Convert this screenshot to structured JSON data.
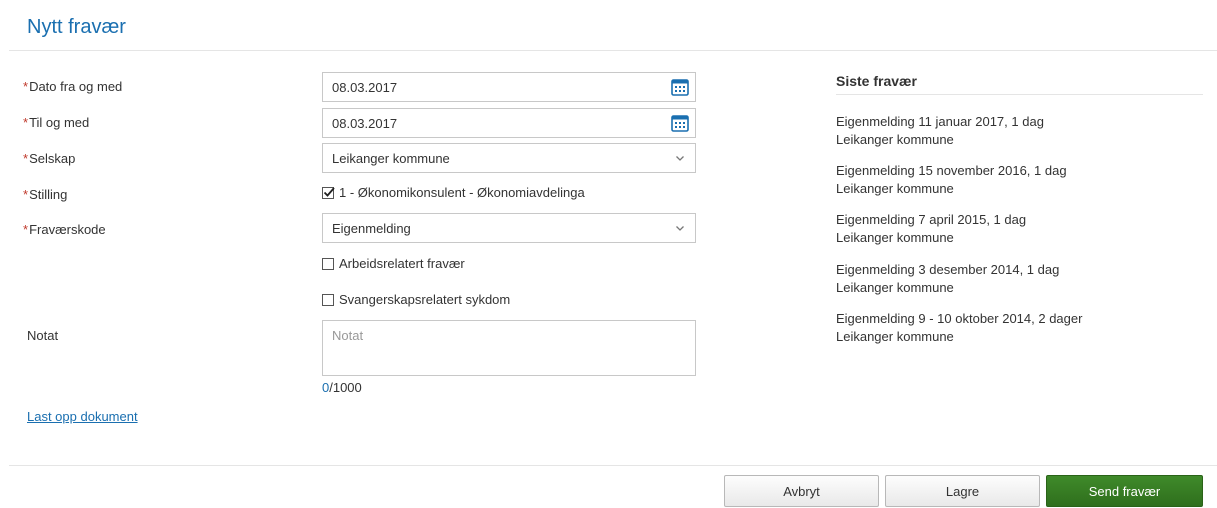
{
  "page": {
    "title": "Nytt fravær"
  },
  "form": {
    "required_mark": "*",
    "date_from": {
      "label": "Dato fra og med",
      "value": "08.03.2017"
    },
    "date_to": {
      "label": "Til og med",
      "value": "08.03.2017"
    },
    "company": {
      "label": "Selskap",
      "value": "Leikanger kommune"
    },
    "position": {
      "label": "Stilling",
      "option": "1 - Økonomikonsulent - Økonomiavdelinga",
      "checked": true
    },
    "absence_code": {
      "label": "Fraværskode",
      "value": "Eigenmelding"
    },
    "work_related": {
      "label": "Arbeidsrelatert fravær",
      "checked": false
    },
    "pregnancy_related": {
      "label": "Svangerskapsrelatert sykdom",
      "checked": false
    },
    "note": {
      "label": "Notat",
      "placeholder": "Notat",
      "count": "0",
      "max": "/1000"
    },
    "upload_link": "Last opp dokument"
  },
  "sidebar": {
    "title": "Siste fravær",
    "items": [
      {
        "line1": "Eigenmelding 11 januar 2017, 1 dag",
        "line2": "Leikanger kommune"
      },
      {
        "line1": "Eigenmelding 15 november 2016, 1 dag",
        "line2": "Leikanger kommune"
      },
      {
        "line1": "Eigenmelding 7 april 2015, 1 dag",
        "line2": "Leikanger kommune"
      },
      {
        "line1": "Eigenmelding 3 desember 2014, 1 dag",
        "line2": "Leikanger kommune"
      },
      {
        "line1": "Eigenmelding 9 - 10 oktober 2014, 2 dager",
        "line2": "Leikanger kommune"
      }
    ]
  },
  "buttons": {
    "cancel": "Avbryt",
    "save": "Lagre",
    "send": "Send fravær"
  },
  "colors": {
    "accent": "#1a6fb0",
    "primary_button": "#3a7f26",
    "required": "#c0392b"
  },
  "icons": {
    "calendar": "calendar-icon",
    "chevron": "chevron-down-icon",
    "check": "checkmark-icon"
  }
}
